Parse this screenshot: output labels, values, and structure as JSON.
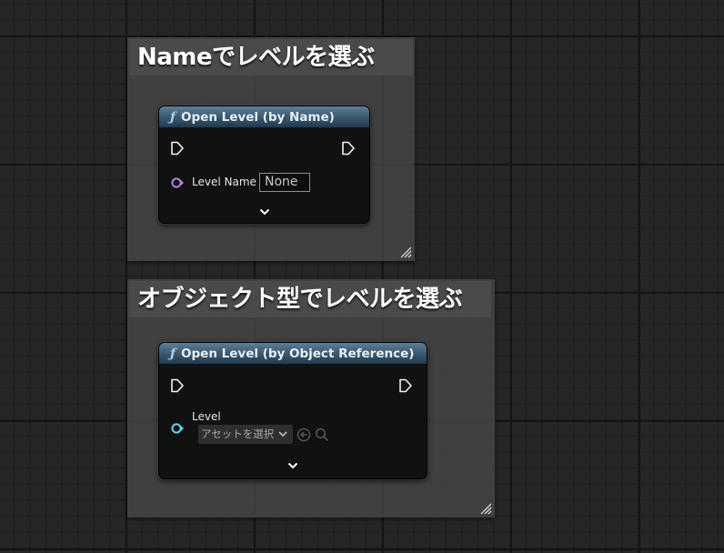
{
  "comments": [
    {
      "title": "Nameでレベルを選ぶ",
      "node": {
        "title": "Open Level (by Name)",
        "function_icon": "ƒ",
        "pin_label": "Level Name",
        "input_value": "None"
      }
    },
    {
      "title": "オブジェクト型でレベルを選ぶ",
      "node": {
        "title": "Open Level (by Object Reference)",
        "function_icon": "ƒ",
        "pin_label": "Level",
        "asset_picker_text": "アセットを選択"
      }
    }
  ],
  "colors": {
    "name_pin": "#b47fe0",
    "object_pin": "#63d1e6",
    "node_header": "#3e5d74",
    "comment_bg": "#484848"
  },
  "icons": {
    "function": "function-icon",
    "exec": "exec-pin-icon",
    "expand": "chevron-down-icon",
    "browse": "arrow-left-circle-icon",
    "search": "search-icon",
    "resize": "resize-grip-icon"
  }
}
